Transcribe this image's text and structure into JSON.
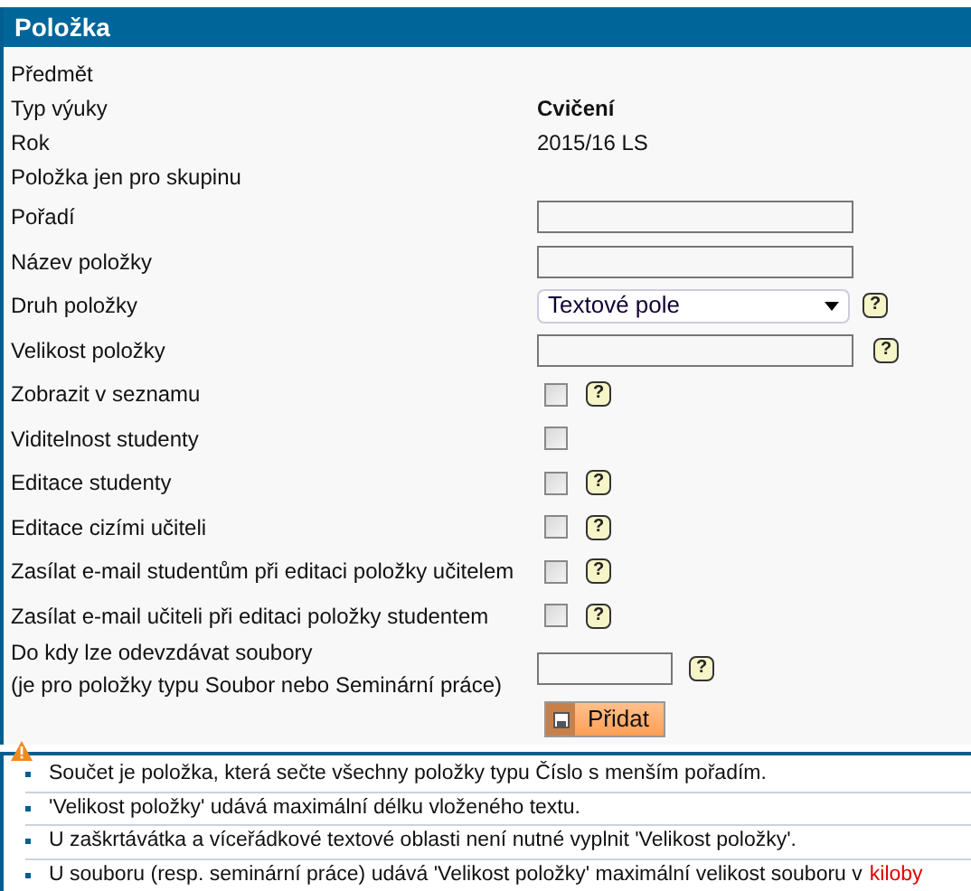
{
  "panel": {
    "title": "Položka"
  },
  "rows": [
    {
      "kind": "text",
      "label": "Předmět"
    },
    {
      "kind": "text",
      "label": "Typ výuky",
      "value": "Cvičení"
    },
    {
      "kind": "text",
      "label": "Rok",
      "value": "2015/16 LS"
    },
    {
      "kind": "text",
      "label": "Položka jen pro skupinu"
    },
    {
      "kind": "input",
      "label": "Pořadí"
    },
    {
      "kind": "input",
      "label": "Název položky"
    },
    {
      "kind": "select",
      "label": "Druh položky",
      "value": "Textové pole",
      "help": "?"
    },
    {
      "kind": "input",
      "label": "Velikost položky",
      "help": "?"
    },
    {
      "kind": "checkbox",
      "label": "Zobrazit v seznamu",
      "checked": false,
      "help": "?"
    },
    {
      "kind": "checkbox",
      "label": "Viditelnost studenty",
      "checked": false
    },
    {
      "kind": "checkbox",
      "label": "Editace studenty",
      "checked": false,
      "help": "?"
    },
    {
      "kind": "checkbox",
      "label": "Editace cizími učiteli",
      "checked": false,
      "help": "?"
    },
    {
      "kind": "checkbox",
      "label": "Zasílat e-mail studentům při editaci položky učitelem",
      "checked": false,
      "help": "?"
    },
    {
      "kind": "checkbox",
      "label": "Zasílat e-mail učiteli při editaci položky studentem",
      "checked": false,
      "help": "?"
    },
    {
      "kind": "short",
      "label": "Do kdy lze odevzdávat soubory",
      "sublabel": "(je pro položky typu Soubor nebo Seminární práce)",
      "help": "?"
    }
  ],
  "add_button": "Přidat",
  "notes": [
    {
      "text": "Součet je položka, která sečte všechny položky typu Číslo s menším pořadím."
    },
    {
      "text": "'Velikost položky' udává maximální délku vloženého textu."
    },
    {
      "text": "U zaškrtávátka a víceřádkové textové oblasti není nutné vyplnit 'Velikost položky'."
    },
    {
      "text": "U souboru (resp. seminární práce) udává 'Velikost položky' maximální velikost souboru v",
      "link": "kiloby"
    }
  ]
}
